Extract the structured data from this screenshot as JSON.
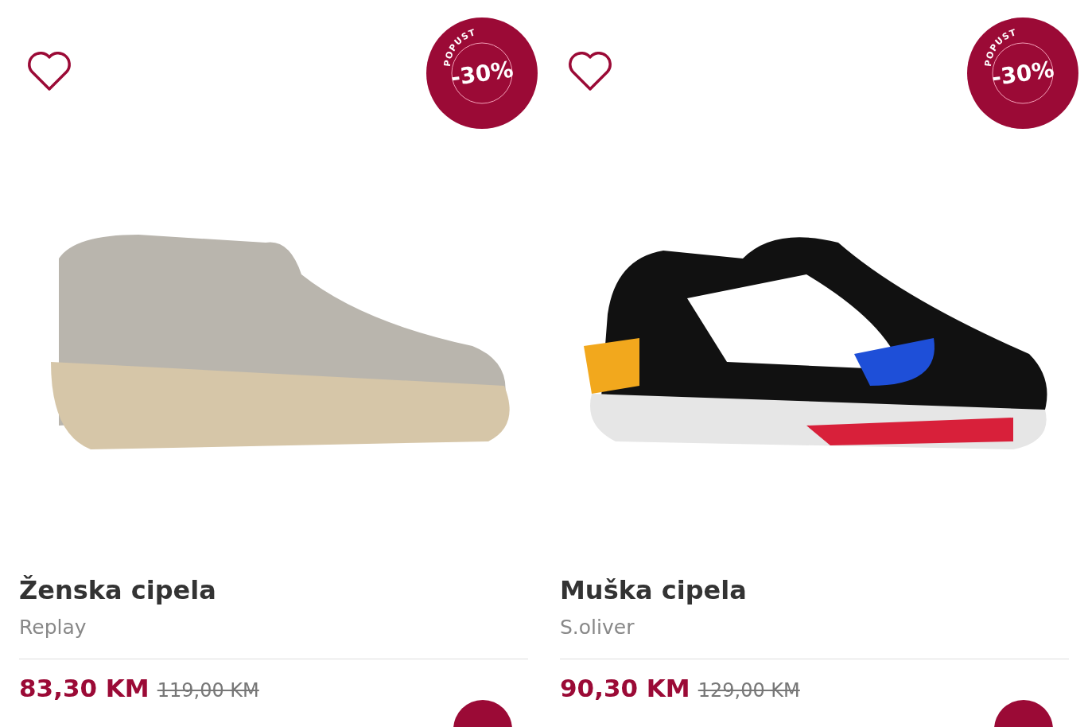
{
  "products": [
    {
      "badge": {
        "label": "POPUST",
        "discount": "-30%"
      },
      "favorite": false,
      "kind": "espadrille",
      "title": "Ženska cipela",
      "brand": "Replay",
      "price": "83,30 KM",
      "old_price": "119,00 KM"
    },
    {
      "badge": {
        "label": "POPUST",
        "discount": "-30%"
      },
      "favorite": false,
      "kind": "sneaker",
      "title": "Muška cipela",
      "brand": "S.oliver",
      "price": "90,30 KM",
      "old_price": "129,00 KM"
    }
  ]
}
